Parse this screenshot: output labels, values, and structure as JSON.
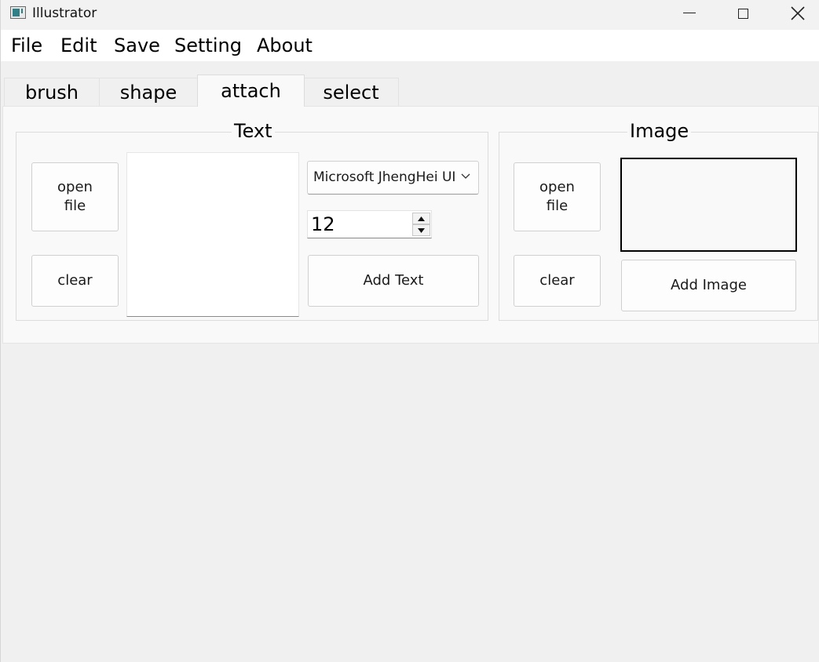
{
  "window": {
    "title": "Illustrator",
    "controls": {
      "minimize": "minimize-icon",
      "maximize": "maximize-icon",
      "close": "close-icon"
    }
  },
  "menubar": {
    "items": [
      {
        "label": "File"
      },
      {
        "label": "Edit"
      },
      {
        "label": "Save"
      },
      {
        "label": "Setting"
      },
      {
        "label": "About"
      }
    ]
  },
  "tabs": {
    "items": [
      {
        "label": "brush"
      },
      {
        "label": "shape"
      },
      {
        "label": "attach"
      },
      {
        "label": "select"
      }
    ],
    "active": "attach"
  },
  "text_group": {
    "title": "Text",
    "open_file_label": "open\nfile",
    "clear_label": "clear",
    "text_value": "",
    "font_select": {
      "value": "Microsoft JhengHei UI"
    },
    "font_size": {
      "value": "12"
    },
    "add_label": "Add Text"
  },
  "image_group": {
    "title": "Image",
    "open_file_label": "open\nfile",
    "clear_label": "clear",
    "add_label": "Add Image"
  },
  "colors": {
    "background": "#f0f0f0",
    "panel": "#f9f9f9",
    "icon_accent": "#2f7f86"
  }
}
